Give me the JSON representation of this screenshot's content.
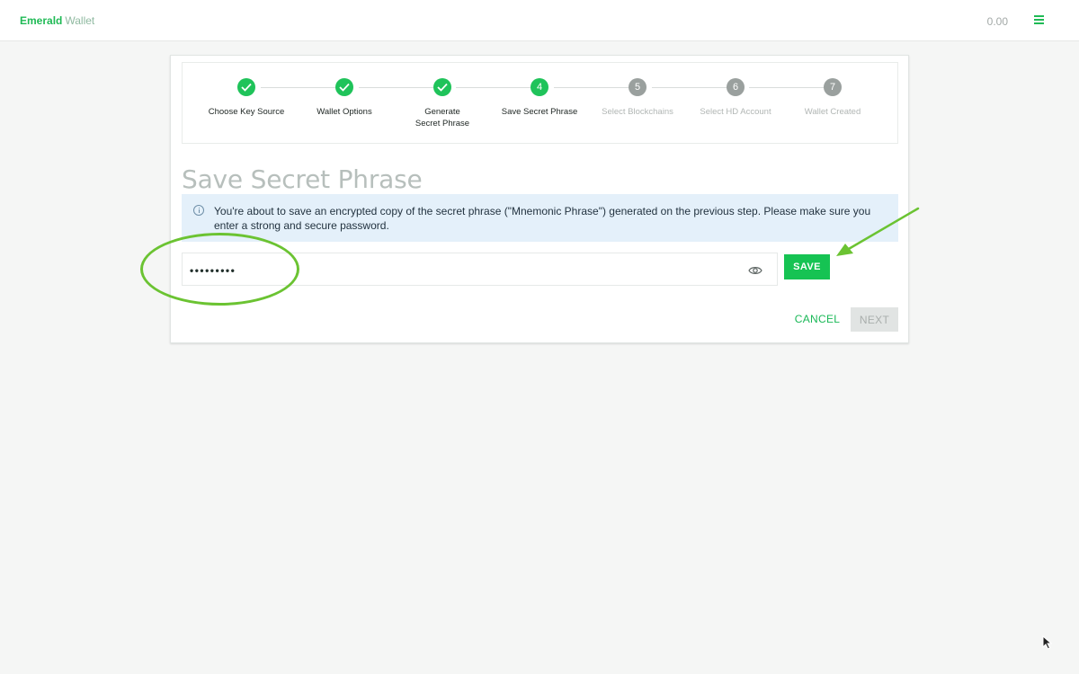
{
  "app": {
    "brand_primary": "Emerald",
    "brand_secondary": "Wallet",
    "balance": "0.00"
  },
  "colors": {
    "accent": "#1fc35a",
    "pending_step": "#9aa09e",
    "alert_bg": "#e4f0fa",
    "annotation": "#6bc332"
  },
  "stepper": {
    "steps": [
      {
        "number": "1",
        "label": "Choose Key Source",
        "status": "done"
      },
      {
        "number": "2",
        "label": "Wallet Options",
        "status": "done"
      },
      {
        "number": "3",
        "label": "Generate Secret Phrase",
        "status": "done"
      },
      {
        "number": "4",
        "label": "Save Secret Phrase",
        "status": "active"
      },
      {
        "number": "5",
        "label": "Select Blockchains",
        "status": "pending"
      },
      {
        "number": "6",
        "label": "Select HD Account",
        "status": "pending"
      },
      {
        "number": "7",
        "label": "Wallet Created",
        "status": "pending"
      }
    ]
  },
  "main": {
    "title": "Save Secret Phrase",
    "info_text": "You're about to save an encrypted copy of the secret phrase (\"Mnemonic Phrase\") generated on the previous step. Please make sure you enter a strong and secure password.",
    "password_value": "•••••••••",
    "save_label": "SAVE",
    "cancel_label": "CANCEL",
    "next_label": "NEXT"
  }
}
